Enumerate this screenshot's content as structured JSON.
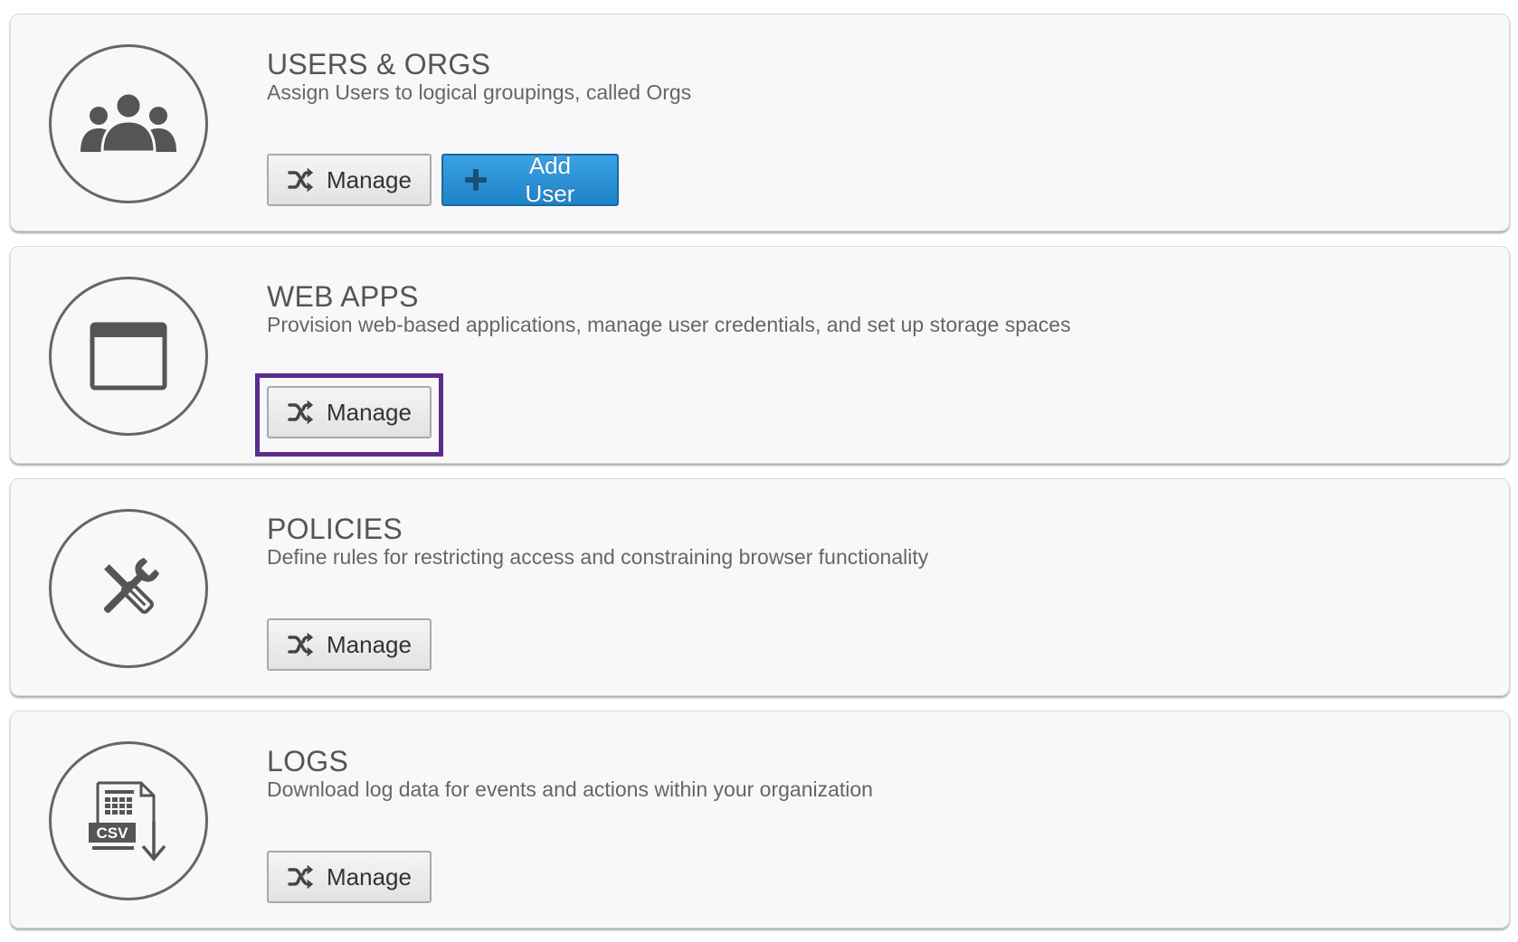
{
  "sections": [
    {
      "title": "USERS & ORGS",
      "description": "Assign Users to logical groupings, called Orgs",
      "icon": "users-group-icon",
      "manage_label": "Manage",
      "add_user_label": "Add User"
    },
    {
      "title": "WEB APPS",
      "description": "Provision web-based applications, manage user credentials, and set up storage spaces",
      "icon": "browser-window-icon",
      "manage_label": "Manage"
    },
    {
      "title": "POLICIES",
      "description": "Define rules for restricting access and constraining browser functionality",
      "icon": "tools-icon",
      "manage_label": "Manage"
    },
    {
      "title": "LOGS",
      "description": "Download log data for events and actions within your organization",
      "icon": "csv-download-icon",
      "icon_text": "CSV",
      "manage_label": "Manage"
    }
  ],
  "colors": {
    "primary_button": "#2a8fd6",
    "highlight_border": "#5b2d8e",
    "icon_gray": "#555555"
  }
}
